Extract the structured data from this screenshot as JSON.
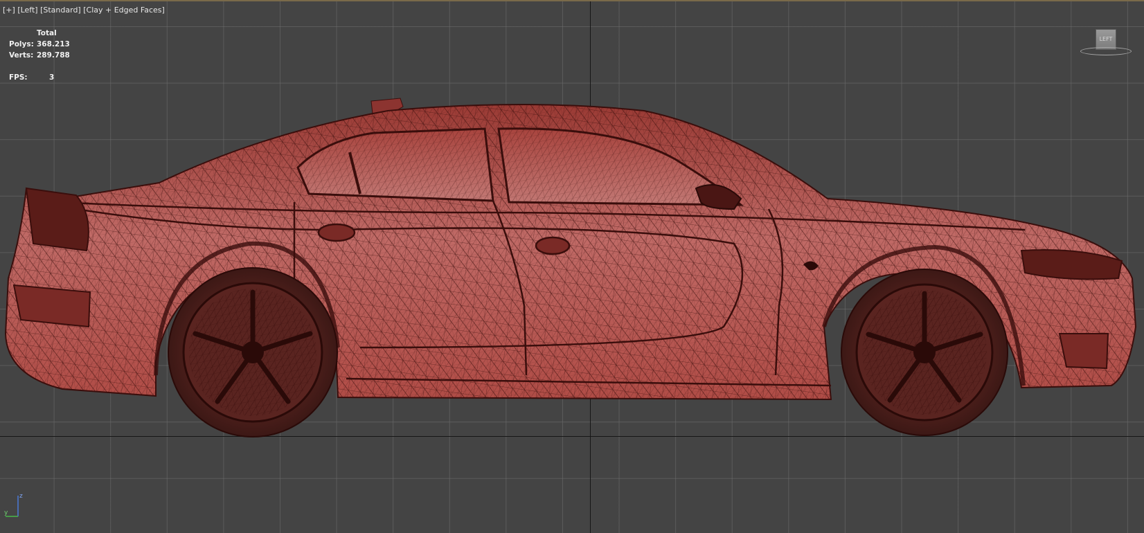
{
  "viewport": {
    "label_parts": [
      "[+]",
      "[Left]",
      "[Standard]",
      "[Clay + Edged Faces]"
    ],
    "stats": {
      "header": "Total",
      "polys_label": "Polys:",
      "polys_value": "368.213",
      "verts_label": "Verts:",
      "verts_value": "289.788",
      "fps_label": "FPS:",
      "fps_value": "3"
    },
    "viewcube": {
      "face_label": "LEFT"
    },
    "axis_gizmo": {
      "labels": [
        "z",
        "y"
      ]
    }
  },
  "colors": {
    "background": "#444444",
    "grid": "#6e6e6e",
    "car_body": "#b0504a",
    "wireframe": "#3a0e0c",
    "tire": "#3c1815"
  }
}
